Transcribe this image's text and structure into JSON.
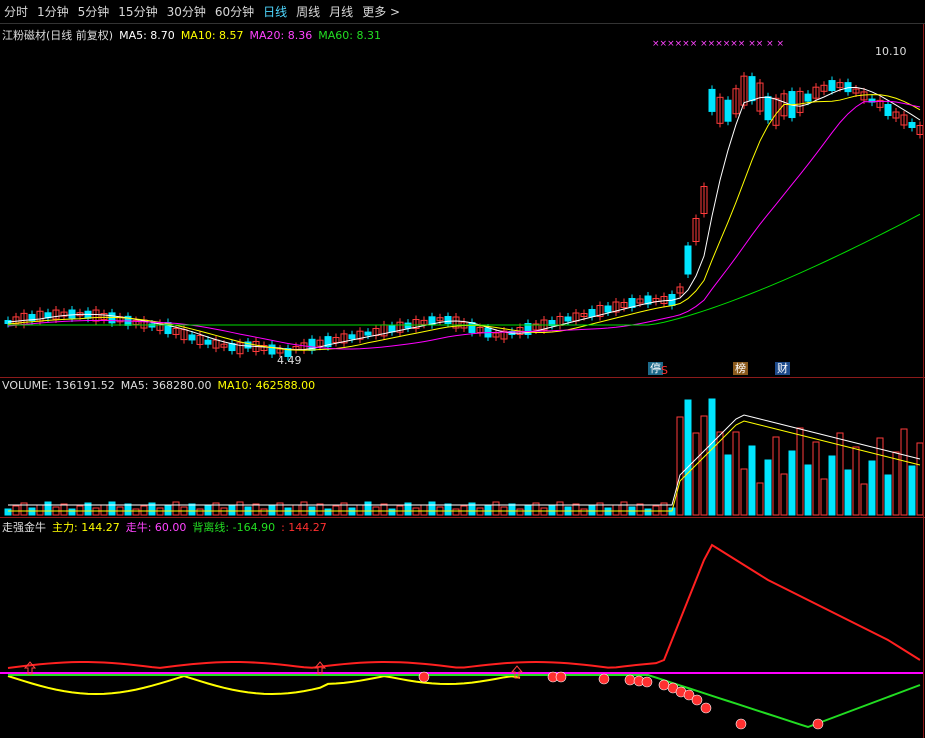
{
  "toolbar": {
    "items": [
      "分时",
      "1分钟",
      "5分钟",
      "15分钟",
      "30分钟",
      "60分钟",
      "日线",
      "周线",
      "月线",
      "更多 >"
    ],
    "active_index": 6
  },
  "price_panel": {
    "stock": "江粉磁材(日线 前复权)",
    "ma5": "MA5: 8.70",
    "ma10": "MA10: 8.57",
    "ma20": "MA20: 8.36",
    "ma60": "MA60: 8.31",
    "high_label": "10.10",
    "low_label": "4.49",
    "markers": [
      "停",
      "S",
      "榜",
      "财"
    ],
    "limit_up_marks": "×××××× ×××××× ×× × ×",
    "colors": {
      "up": "#ff3b3b",
      "down": "#00e5ff",
      "ma5": "#ffffff",
      "ma10": "#ffff00",
      "ma20": "#ff00ff",
      "ma60": "#00dd00"
    }
  },
  "volume_panel": {
    "volume": "VOLUME: 136191.52",
    "ma5": "MA5: 368280.00",
    "ma10": "MA10: 462588.00"
  },
  "indicator_panel": {
    "name": "走强金牛",
    "zhuli": "主力: 144.27",
    "zouniu": "走牛: 60.00",
    "beili": "背离线: -164.90",
    "extra": ": 144.27"
  }
}
